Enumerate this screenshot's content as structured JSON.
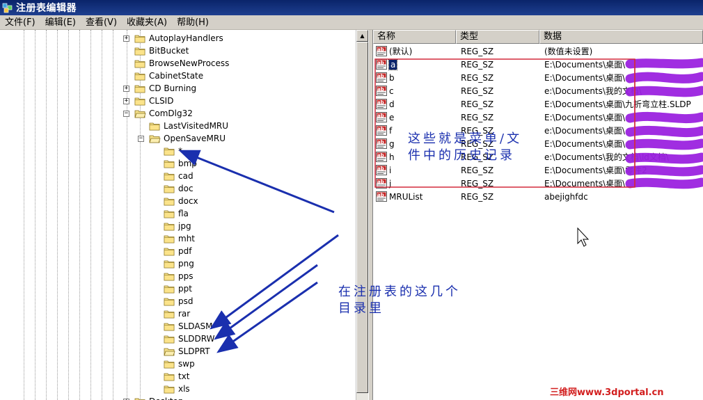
{
  "window": {
    "title": "注册表编辑器"
  },
  "menu": [
    {
      "label": "文件(F)"
    },
    {
      "label": "编辑(E)"
    },
    {
      "label": "查看(V)"
    },
    {
      "label": "收藏夹(A)"
    },
    {
      "label": "帮助(H)"
    }
  ],
  "tree": {
    "items": [
      {
        "label": "AutoplayHandlers",
        "expander": "+"
      },
      {
        "label": "BitBucket",
        "expander": ""
      },
      {
        "label": "BrowseNewProcess",
        "expander": ""
      },
      {
        "label": "CabinetState",
        "expander": ""
      },
      {
        "label": "CD Burning",
        "expander": "+"
      },
      {
        "label": "CLSID",
        "expander": "+"
      },
      {
        "label": "ComDlg32",
        "expander": "-"
      },
      {
        "label": "LastVisitedMRU",
        "expander": ""
      },
      {
        "label": "OpenSaveMRU",
        "expander": "-"
      },
      {
        "label": "*",
        "expander": ""
      },
      {
        "label": "bmp",
        "expander": ""
      },
      {
        "label": "cad",
        "expander": ""
      },
      {
        "label": "doc",
        "expander": ""
      },
      {
        "label": "docx",
        "expander": ""
      },
      {
        "label": "fla",
        "expander": ""
      },
      {
        "label": "jpg",
        "expander": ""
      },
      {
        "label": "mht",
        "expander": ""
      },
      {
        "label": "pdf",
        "expander": ""
      },
      {
        "label": "png",
        "expander": ""
      },
      {
        "label": "pps",
        "expander": ""
      },
      {
        "label": "ppt",
        "expander": ""
      },
      {
        "label": "psd",
        "expander": ""
      },
      {
        "label": "rar",
        "expander": ""
      },
      {
        "label": "SLDASM",
        "expander": ""
      },
      {
        "label": "SLDDRW",
        "expander": ""
      },
      {
        "label": "SLDPRT",
        "expander": ""
      },
      {
        "label": "swp",
        "expander": ""
      },
      {
        "label": "txt",
        "expander": ""
      },
      {
        "label": "xls",
        "expander": ""
      },
      {
        "label": "Desktop",
        "expander": "+"
      }
    ]
  },
  "list": {
    "columns": [
      {
        "label": "名称"
      },
      {
        "label": "类型"
      },
      {
        "label": "数据"
      }
    ],
    "rows": [
      {
        "name": "(默认)",
        "type": "REG_SZ",
        "data": "(数值未设置)"
      },
      {
        "name": "a",
        "type": "REG_SZ",
        "data": "E:\\Documents\\桌面\\"
      },
      {
        "name": "b",
        "type": "REG_SZ",
        "data": "E:\\Documents\\桌面\\"
      },
      {
        "name": "c",
        "type": "REG_SZ",
        "data": "e:\\Documents\\我的文档\\"
      },
      {
        "name": "d",
        "type": "REG_SZ",
        "data": "E:\\Documents\\桌面\\九折弯立柱.SLDP"
      },
      {
        "name": "e",
        "type": "REG_SZ",
        "data": "E:\\Documents\\桌面\\"
      },
      {
        "name": "f",
        "type": "REG_SZ",
        "data": "e:\\Documents\\桌面\\"
      },
      {
        "name": "g",
        "type": "REG_SZ",
        "data": "E:\\Documents\\桌面\\"
      },
      {
        "name": "h",
        "type": "REG_SZ",
        "data": "e:\\Documents\\我的文档\\ld文档\\"
      },
      {
        "name": "i",
        "type": "REG_SZ",
        "data": "E:\\Documents\\桌面\\零件2"
      },
      {
        "name": "j",
        "type": "REG_SZ",
        "data": "E:\\Documents\\桌面\\"
      },
      {
        "name": "MRUList",
        "type": "REG_SZ",
        "data": "abejighfdc"
      }
    ]
  },
  "annotations": {
    "note_history_line1": "这些就是菜单/文",
    "note_history_line2": "件中的历史记录",
    "note_registry_line1": "在注册表的这几个",
    "note_registry_line2": "目录里",
    "watermark": "三维网www.3dportal.cn",
    "colors": {
      "pen": "#1a2fae",
      "redbox": "#d42a3c",
      "scribble": "#9b22e0"
    }
  }
}
